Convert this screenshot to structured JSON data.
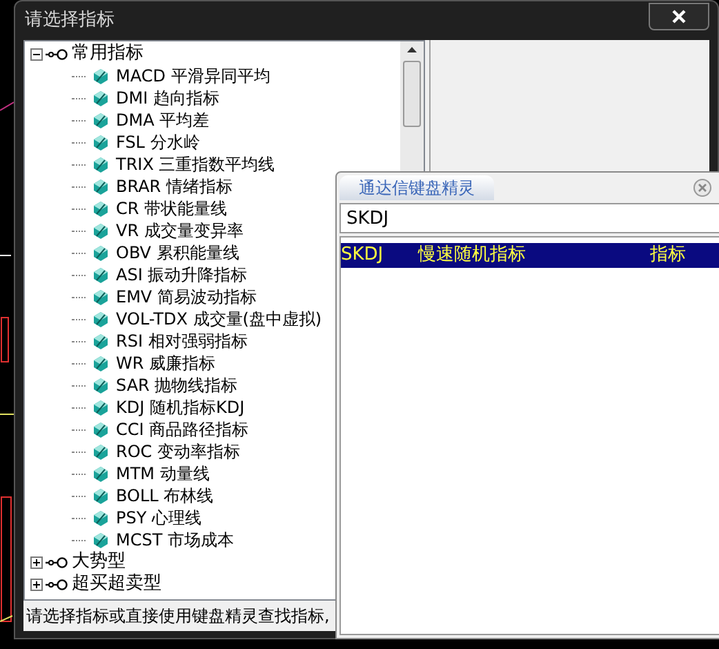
{
  "window": {
    "title": "请选择指标"
  },
  "tree": [
    {
      "label": "常用指标",
      "expanded": true,
      "children": [
        {
          "label": "MACD 平滑异同平均"
        },
        {
          "label": "DMI 趋向指标"
        },
        {
          "label": "DMA 平均差"
        },
        {
          "label": "FSL 分水岭"
        },
        {
          "label": "TRIX 三重指数平均线"
        },
        {
          "label": "BRAR 情绪指标"
        },
        {
          "label": "CR 带状能量线"
        },
        {
          "label": "VR 成交量变异率"
        },
        {
          "label": "OBV 累积能量线"
        },
        {
          "label": "ASI 振动升降指标"
        },
        {
          "label": "EMV 简易波动指标"
        },
        {
          "label": "VOL-TDX 成交量(盘中虚拟)"
        },
        {
          "label": "RSI 相对强弱指标"
        },
        {
          "label": "WR 威廉指标"
        },
        {
          "label": "SAR 抛物线指标"
        },
        {
          "label": "KDJ 随机指标KDJ"
        },
        {
          "label": "CCI 商品路径指标"
        },
        {
          "label": "ROC 变动率指标"
        },
        {
          "label": "MTM 动量线"
        },
        {
          "label": "BOLL 布林线"
        },
        {
          "label": "PSY 心理线"
        },
        {
          "label": "MCST 市场成本"
        }
      ]
    },
    {
      "label": "大势型",
      "expanded": false
    },
    {
      "label": "超买超卖型",
      "expanded": false
    }
  ],
  "status_text": "请选择指标或直接使用键盘精灵查找指标,",
  "keyboard_wizard": {
    "title": "通达信键盘精灵",
    "query": "SKDJ",
    "results": [
      {
        "code": "SKDJ",
        "name": "慢速随机指标",
        "type": "指标",
        "selected": true
      }
    ]
  }
}
